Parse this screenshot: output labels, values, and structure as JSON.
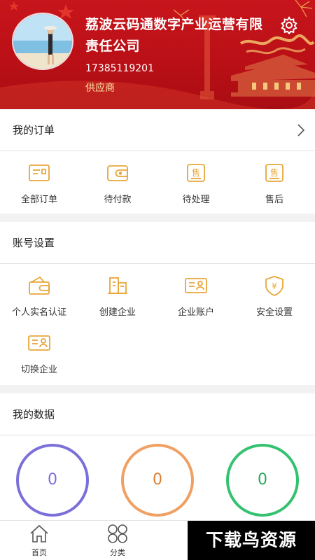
{
  "profile": {
    "company_name": "荔波云码通数字产业运营有限责任公司",
    "phone": "17385119201",
    "role": "供应商"
  },
  "orders": {
    "title": "我的订单",
    "items": [
      {
        "label": "全部订单",
        "icon": "receipt-icon"
      },
      {
        "label": "待付款",
        "icon": "wallet-icon"
      },
      {
        "label": "待处理",
        "icon": "sale-doc-icon"
      },
      {
        "label": "售后",
        "icon": "after-sale-icon"
      }
    ]
  },
  "account": {
    "title": "账号设置",
    "items": [
      {
        "label": "个人实名认证",
        "icon": "wallet-icon"
      },
      {
        "label": "创建企业",
        "icon": "building-icon"
      },
      {
        "label": "企业账户",
        "icon": "id-card-icon"
      },
      {
        "label": "安全设置",
        "icon": "shield-yen-icon"
      },
      {
        "label": "切换企业",
        "icon": "id-card-icon"
      }
    ]
  },
  "stats": {
    "title": "我的数据",
    "items": [
      {
        "value": "0",
        "label": "",
        "color": "#7b6fd9"
      },
      {
        "value": "0",
        "label": "",
        "color": "#f0a063"
      },
      {
        "value": "0",
        "label": "",
        "color": "#35c270"
      }
    ]
  },
  "tabbar": {
    "items": [
      {
        "label": "首页",
        "icon": "home-icon"
      },
      {
        "label": "分类",
        "icon": "category-icon"
      }
    ]
  },
  "watermark": "下载鸟资源",
  "colors": {
    "header_red": "#c8151c",
    "icon_orange": "#e8a63a",
    "role_text": "#ffe2a6"
  }
}
